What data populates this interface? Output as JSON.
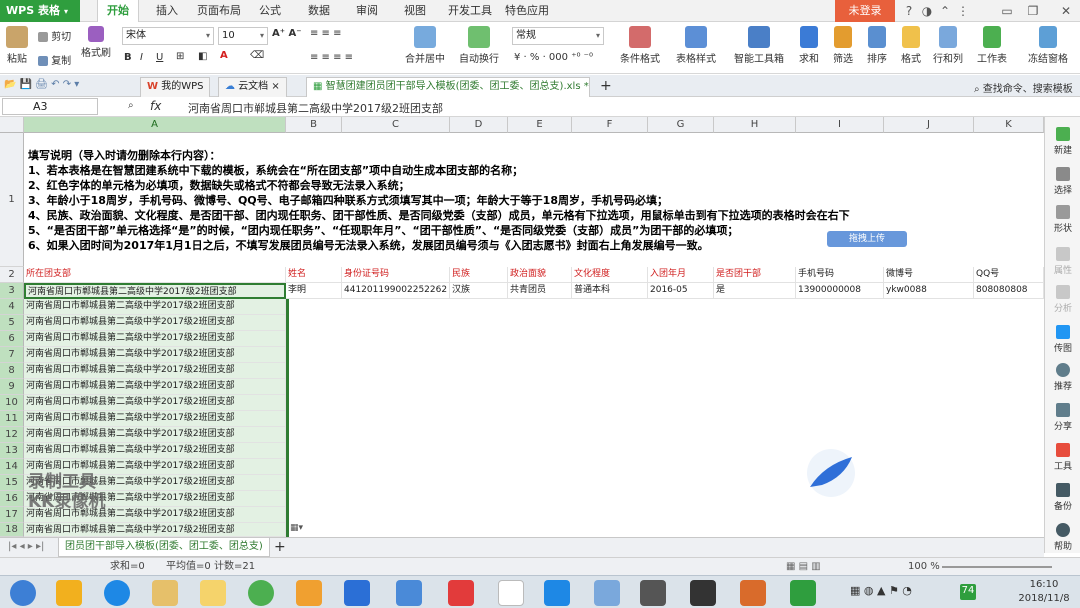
{
  "app": {
    "logo": "WPS 表格",
    "login": "未登录"
  },
  "menu_tabs": [
    "开始",
    "插入",
    "页面布局",
    "公式",
    "数据",
    "审阅",
    "视图",
    "开发工具",
    "特色应用"
  ],
  "ribbon": {
    "cut": "剪切",
    "copy": "复制",
    "format_painter": "格式刷",
    "paste": "粘贴",
    "font": "宋体",
    "size": "10",
    "merge": "合并居中",
    "wrap": "自动换行",
    "number_format": "常规",
    "cond_format": "条件格式",
    "table_style": "表格样式",
    "smart_toolbox": "智能工具箱",
    "sum": "求和",
    "filter": "筛选",
    "sort": "排序",
    "format": "格式",
    "rowcol": "行和列",
    "sheet": "工作表",
    "freeze": "冻结窗格"
  },
  "doc_tabs": {
    "my_wps": "我的WPS",
    "cloud": "云文档",
    "file": "智慧团建团员团干部导入模板(团委、团工委、团总支).xls *",
    "search": "查找命令、搜索模板"
  },
  "formula_bar": {
    "name_box": "A3",
    "fx": "fx",
    "content": "河南省周口市郸城县第二高级中学2017级2班团支部"
  },
  "columns": [
    "A",
    "B",
    "C",
    "D",
    "E",
    "F",
    "G",
    "H",
    "I",
    "J",
    "K"
  ],
  "notes": [
    "填写说明（导入时请勿删除本行内容）：",
    "1、若本表格是在智慧团建系统中下载的模板，系统会在“所在团支部”项中自动生成本团支部的名称；",
    "2、红色字体的单元格为必填项，数据缺失或格式不符都会导致无法录入系统；",
    "3、年龄小于18周岁，手机号码、微博号、QQ号、电子邮箱四种联系方式须填写其中一项；年龄大于等于18周岁，手机号码必填；",
    "4、民族、政治面貌、文化程度、是否团干部、团内现任职务、团干部性质、是否同级党委（支部）成员，单元格有下拉选项，用鼠标单击到有下拉选项的表格时会在右下",
    "5、“是否团干部”单元格选择“是”的时候，“团内现任职务”、“任现职年月”、“团干部性质”、“是否同级党委（支部）成员”为团干部的必填项；",
    "6、如果入团时间为2017年1月1日之后，不填写发展团员编号无法录入系统，发展团员编号须与《入团志愿书》封面右上角发展编号一致。"
  ],
  "headers": [
    "所在团支部",
    "姓名",
    "身份证号码",
    "民族",
    "政治面貌",
    "文化程度",
    "入团年月",
    "是否团干部",
    "手机号码",
    "微博号",
    "QQ号"
  ],
  "row3": [
    "河南省周口市郸城县第二高级中学2017级2班团支部",
    "李明",
    "441201199002252262",
    "汉族",
    "共青团员",
    "普通本科",
    "2016-05",
    "是",
    "13900000008",
    "ykw0088",
    "808080808"
  ],
  "branch": "河南省周口市郸城县第二高级中学2017级2班团支部",
  "row_numbers": [
    "1",
    "2",
    "3",
    "4",
    "5",
    "6",
    "7",
    "8",
    "9",
    "10",
    "11",
    "12",
    "13",
    "14",
    "15",
    "16",
    "17",
    "18"
  ],
  "sheet_tab": "团员团干部导入模板(团委、团工委、团总支)",
  "status": {
    "sum": "求和=0",
    "avg": "平均值=0",
    "count": "计数=21",
    "zoom": "100 %"
  },
  "sidebar": [
    "新建",
    "选择",
    "形状",
    "属性",
    "分析",
    "传图",
    "推荐",
    "分享",
    "工具",
    "备份",
    "帮助"
  ],
  "popup": "拖拽上传",
  "watermark": [
    "录制工具",
    "KK录像机"
  ],
  "clock": {
    "time": "16:10",
    "date": "2018/11/8"
  },
  "tray_badge": "74"
}
